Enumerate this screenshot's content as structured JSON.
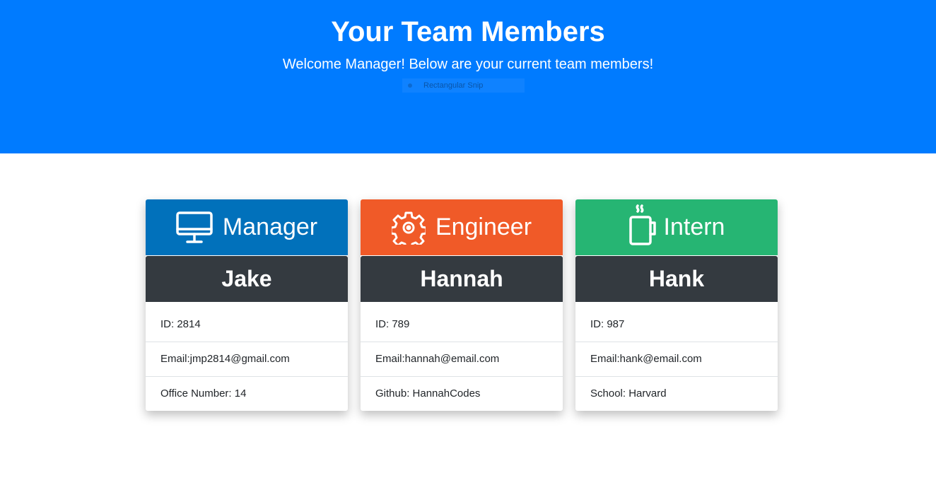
{
  "header": {
    "title": "Your Team Members",
    "subtitle": "Welcome Manager! Below are your current team members!",
    "snip_label": "Rectangular Snip"
  },
  "colors": {
    "header_bg": "#007bff",
    "manager": "#0171bb",
    "engineer": "#f05a28",
    "intern": "#26b573",
    "name_bar": "#343a40"
  },
  "cards": [
    {
      "role": "Manager",
      "icon": "monitor-icon",
      "name": "Jake",
      "id_line": "ID: 2814",
      "email_line": "Email:jmp2814@gmail.com",
      "extra_line": "Office Number: 14"
    },
    {
      "role": "Engineer",
      "icon": "gear-icon",
      "name": "Hannah",
      "id_line": "ID: 789",
      "email_line": "Email:hannah@email.com",
      "extra_line": "Github: HannahCodes"
    },
    {
      "role": "Intern",
      "icon": "coffee-mug-icon",
      "name": "Hank",
      "id_line": "ID: 987",
      "email_line": "Email:hank@email.com",
      "extra_line": "School: Harvard"
    }
  ]
}
